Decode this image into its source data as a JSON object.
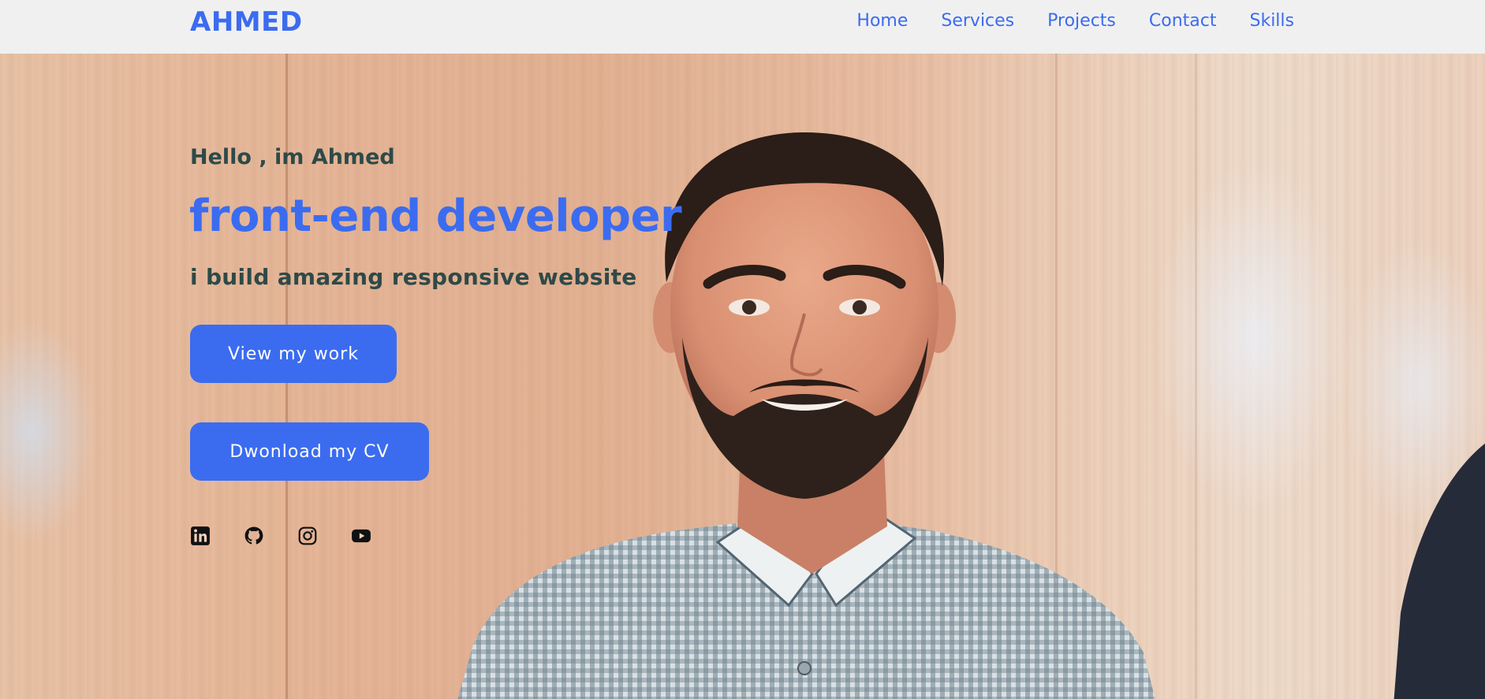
{
  "header": {
    "logo": "AHMED",
    "nav": [
      "Home",
      "Services",
      "Projects",
      "Contact",
      "Skills"
    ]
  },
  "hero": {
    "greeting": "Hello , im Ahmed",
    "headline": "front-end developer",
    "tagline": "i build amazing responsive website",
    "buttons": {
      "work": "View my work",
      "cv": "Dwonload my CV"
    },
    "socials": [
      "linkedin-icon",
      "github-icon",
      "instagram-icon",
      "youtube-icon"
    ]
  },
  "colors": {
    "accent": "#3b6cf0",
    "text_dark": "#2e4a48",
    "navbar_bg": "#f0f0f1"
  }
}
